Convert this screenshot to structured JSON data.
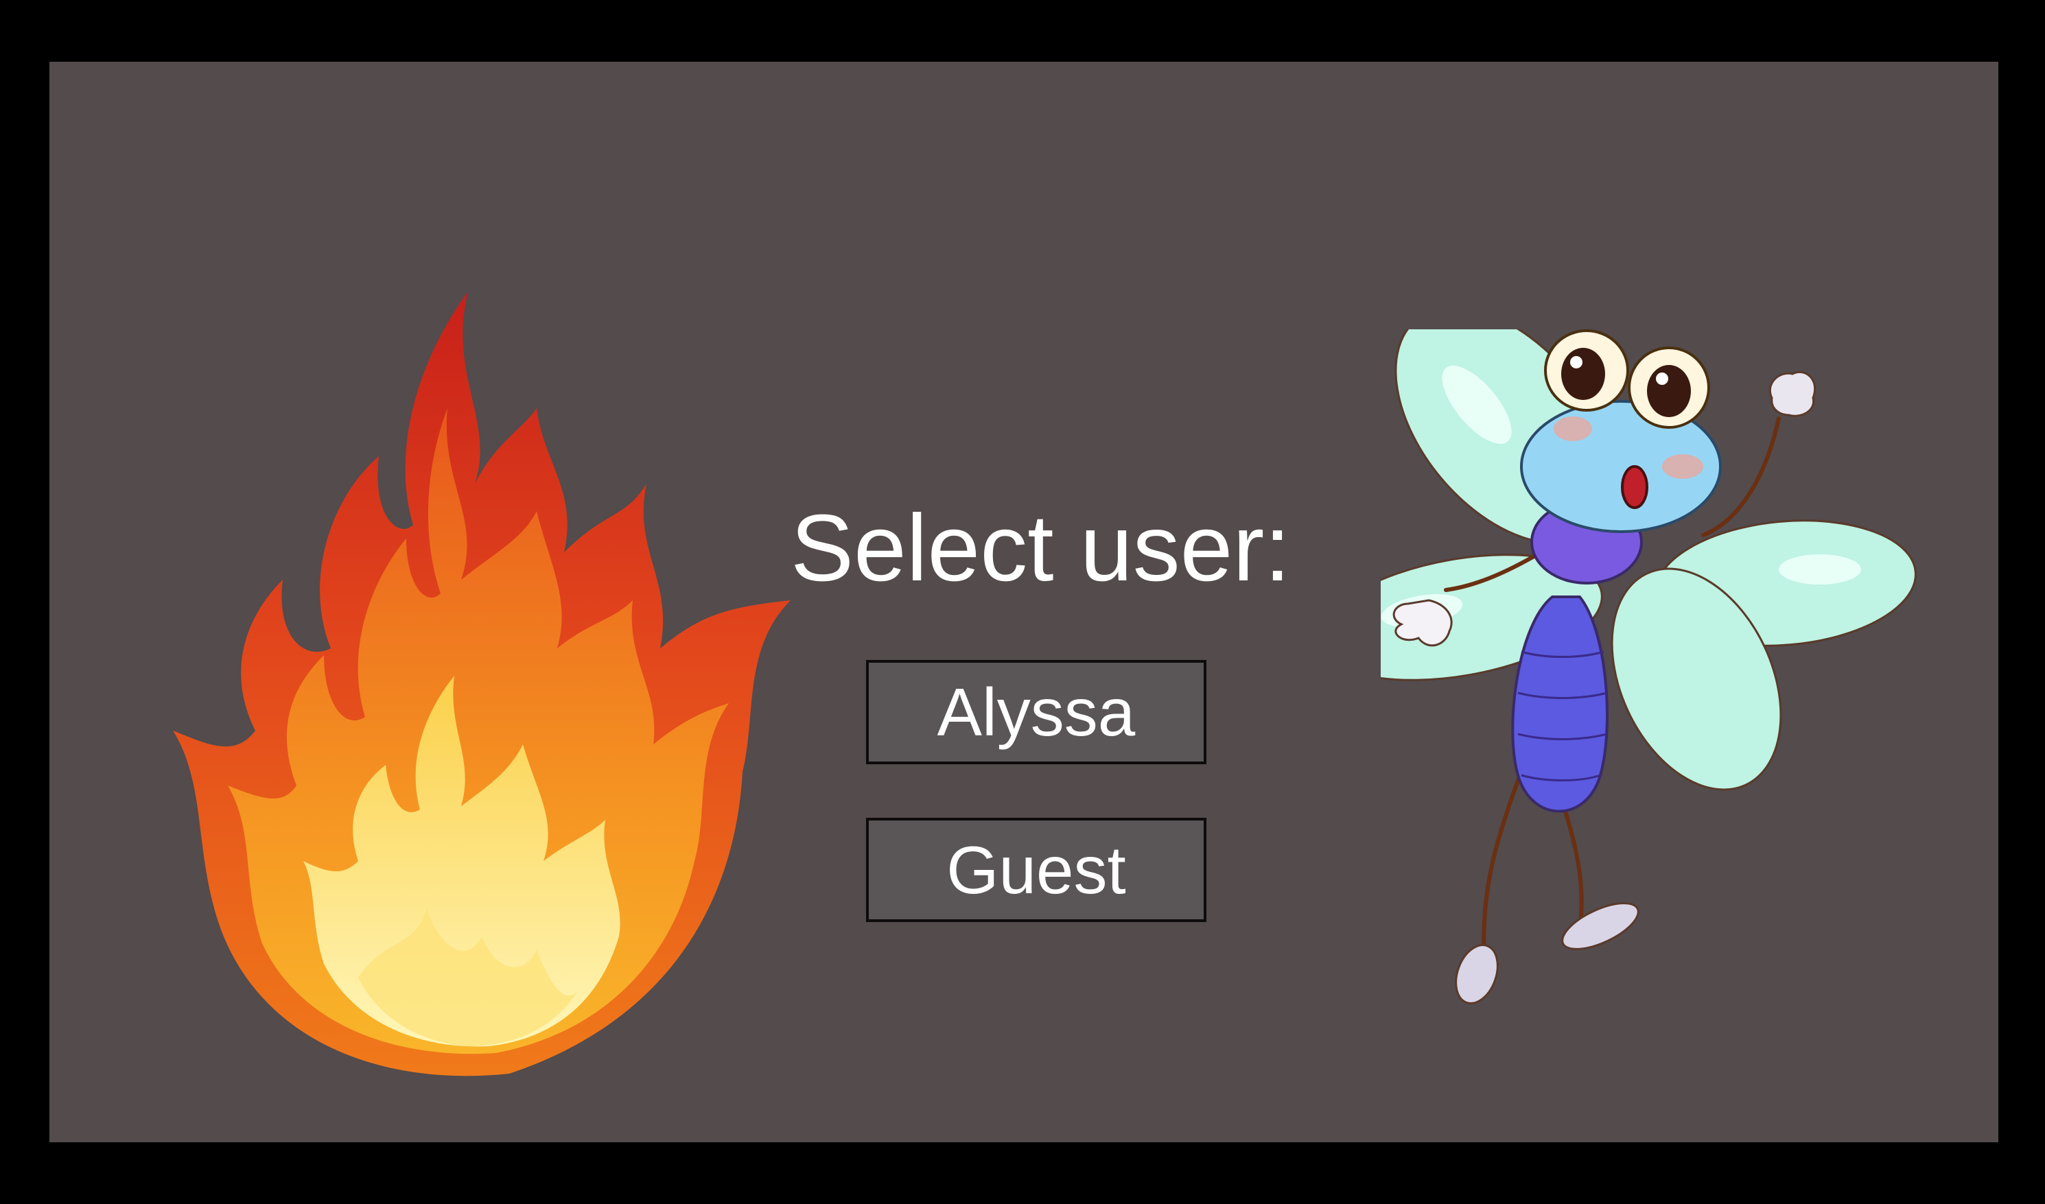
{
  "screen": {
    "background": "#534b4c",
    "frame_color": "#000000"
  },
  "title": "Select user:",
  "users": [
    {
      "label": "Alyssa"
    },
    {
      "label": "Guest"
    }
  ],
  "illustrations": {
    "left": "fire-icon",
    "right": "dragonfly-icon"
  }
}
